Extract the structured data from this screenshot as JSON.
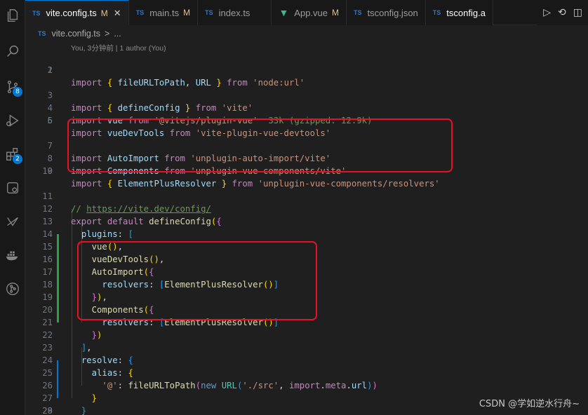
{
  "tabs": [
    {
      "label": "vite.config.ts",
      "icon": "TS",
      "modified": "M",
      "active": true,
      "close": "✕"
    },
    {
      "label": "main.ts",
      "icon": "TS",
      "modified": "M",
      "active": false
    },
    {
      "label": "index.ts",
      "icon": "TS",
      "modified": "",
      "active": false
    },
    {
      "label": "App.vue",
      "icon": "vue",
      "modified": "M",
      "active": false
    },
    {
      "label": "tsconfig.json",
      "icon": "{}",
      "modified": "",
      "active": false
    },
    {
      "label": "tsconfig.a",
      "icon": "TS",
      "modified": "",
      "active": false
    }
  ],
  "breadcrumb": {
    "file": "vite.config.ts",
    "separator": ">",
    "more": "..."
  },
  "codelens": "You, 3分钟前 | 1 author (You)",
  "badges": {
    "source_control": "8",
    "extensions": "2"
  },
  "watermark": "CSDN @学如逆水行舟~",
  "line_numbers": [
    "1",
    "2",
    "3",
    "4",
    "5",
    "6",
    "7",
    "8",
    "9",
    "10",
    "11",
    "12",
    "13",
    "14",
    "15",
    "16",
    "17",
    "18",
    "19",
    "20",
    "21",
    "22",
    "23",
    "24",
    "25",
    "26",
    "27",
    "28",
    "29"
  ],
  "code": {
    "l1": [
      "import",
      " { ",
      "fileURLToPath",
      ", ",
      "URL",
      " } ",
      "from",
      " ",
      "'node:url'"
    ],
    "l3": [
      "import",
      " { ",
      "defineConfig",
      " } ",
      "from",
      " ",
      "'vite'"
    ],
    "l4": [
      "import",
      " ",
      "vue",
      " ",
      "from",
      " ",
      "'@vitejs/plugin-vue'",
      "  33k (gzipped: 12.9k)"
    ],
    "l5": [
      "import",
      " ",
      "vueDevTools",
      " ",
      "from",
      " ",
      "'vite-plugin-vue-devtools'"
    ],
    "l7": [
      "import",
      " ",
      "AutoImport",
      " ",
      "from",
      " ",
      "'unplugin-auto-import/vite'"
    ],
    "l8": [
      "import",
      " ",
      "Components",
      " ",
      "from",
      " ",
      "'unplugin-vue-components/vite'"
    ],
    "l9": [
      "import",
      " { ",
      "ElementPlusResolver",
      " } ",
      "from",
      " ",
      "'unplugin-vue-components/resolvers'"
    ],
    "l11": [
      "// ",
      "https://vite.dev/config/"
    ],
    "l12": [
      "export",
      " ",
      "default",
      " ",
      "defineConfig",
      "(",
      "{"
    ],
    "l13": [
      "  ",
      "plugins",
      ": ",
      "["
    ],
    "l14": [
      "    ",
      "vue",
      "(",
      ")",
      ","
    ],
    "l15": [
      "    ",
      "vueDevTools",
      "(",
      ")",
      ","
    ],
    "l16": [
      "    ",
      "AutoImport",
      "(",
      "{"
    ],
    "l17": [
      "      ",
      "resolvers",
      ": ",
      "[",
      "ElementPlusResolver",
      "(",
      ")",
      "]"
    ],
    "l18": [
      "    ",
      "}",
      ")",
      ","
    ],
    "l19": [
      "    ",
      "Components",
      "(",
      "{"
    ],
    "l20": [
      "      ",
      "resolvers",
      ": ",
      "[",
      "ElementPlusResolver",
      "(",
      ")",
      "]"
    ],
    "l21": [
      "    ",
      "}",
      ")"
    ],
    "l22": [
      "  ",
      "]",
      ","
    ],
    "l23": [
      "  ",
      "resolve",
      ": ",
      "{"
    ],
    "l24": [
      "    ",
      "alias",
      ": ",
      "{"
    ],
    "l25": [
      "      ",
      "'@'",
      ": ",
      "fileURLToPath",
      "(",
      "new",
      " ",
      "URL",
      "(",
      "'./src'",
      ", ",
      "import",
      ".",
      "meta",
      ".",
      "url",
      ")",
      ")"
    ],
    "l26": [
      "    ",
      "}"
    ],
    "l27": [
      "  ",
      "}"
    ],
    "l28": [
      "}",
      ")"
    ]
  }
}
